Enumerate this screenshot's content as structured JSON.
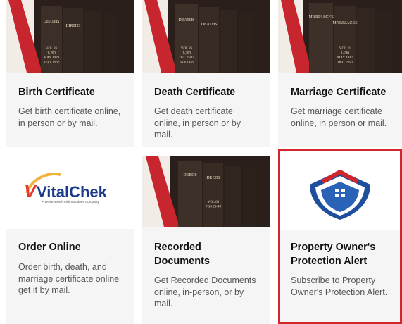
{
  "cards": [
    {
      "title": "Birth Certificate",
      "desc": "Get birth certificate online, in person or by mail.",
      "book_labels": [
        "DEATHS",
        "BIRTHS"
      ],
      "vol_text": "VOL 26\n1-200\nMAY 1929\nSEPT 1932"
    },
    {
      "title": "Death Certificate",
      "desc": "Get death certificate online, in person or by mail.",
      "book_labels": [
        "DEATHS",
        "DEATHS"
      ],
      "vol_text": "VOL 26\n1-200\nDEC 1943\nJAN 1945"
    },
    {
      "title": "Marriage Certificate",
      "desc": "Get marriage certificate online, in person or mail.",
      "book_labels": [
        "MARRIAGES",
        "MARRIAGES"
      ],
      "vol_text": "VOL 31\n1-240\nMAY 1947\nDEC 1950"
    },
    {
      "title": "Order Online",
      "desc": "Order birth, death, and marriage certificate online get it by mail.",
      "logo_text": "VitalChek",
      "logo_sub": "A LexisNexis® Risk Solutions Company"
    },
    {
      "title": "Recorded Documents",
      "desc": "Get Recorded Documents online, in-person, or by mail.",
      "book_labels": [
        "DEEDS",
        "DEEDS"
      ],
      "vol_text": "VOL 68\nPGS 20-40"
    },
    {
      "title": "Property Owner's Protection Alert",
      "desc": "Subscribe to Property Owner's Protection Alert."
    }
  ],
  "colors": {
    "accent_red": "#d0262c",
    "card_bg": "#f5f5f5",
    "vital_blue": "#1b3a8c",
    "vital_red": "#e23a2b",
    "shield_blue": "#1f4e9c"
  }
}
